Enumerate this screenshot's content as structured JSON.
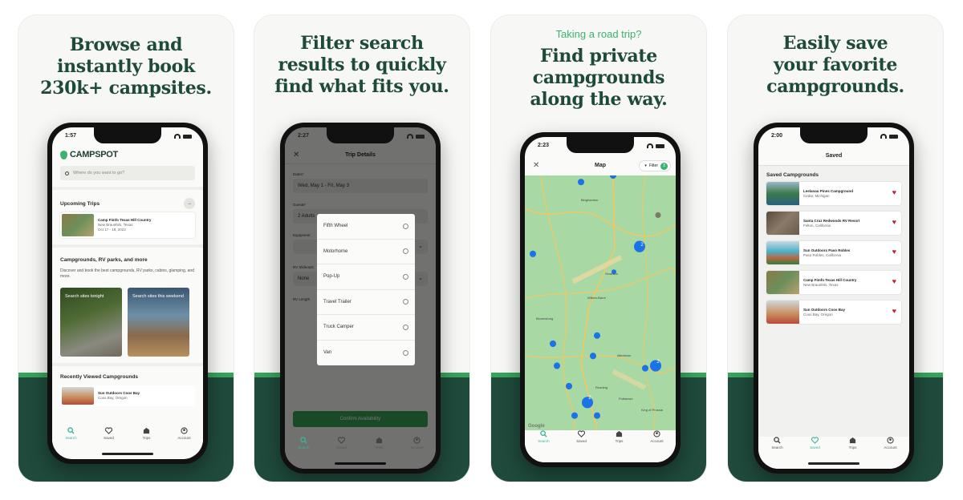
{
  "panels": [
    {
      "headline": [
        "Browse and",
        "instantly book",
        "230k+ campsites."
      ],
      "phone": {
        "time": "1:57",
        "brand": "CAMPSPOT",
        "search_placeholder": "Where do you want to go?",
        "upcoming_title": "Upcoming Trips",
        "upcoming_trip": {
          "name": "Camp Fimfo Texas Hill Country",
          "location": "New Braunfels, Texas",
          "dates": "Oct 17 - 19, 2023"
        },
        "section_title": "Campgrounds, RV parks, and more",
        "section_desc": "Discover and book the best campgrounds, RV parks, cabins, glamping, and more.",
        "promo_tonight": "Search sites tonight",
        "promo_weekend": "Search sites this weekend",
        "recent_title": "Recently Viewed Campgrounds",
        "recent_item": {
          "name": "Sun Outdoors Coos Bay",
          "location": "Coos Bay, Oregon"
        }
      }
    },
    {
      "headline": [
        "Filter search",
        "results to quickly",
        "find what fits you."
      ],
      "phone": {
        "time": "2:27",
        "title": "Trip Details",
        "dates_label": "Dates*",
        "dates_value": "Wed, May 1 - Fri, May 3",
        "guests_label": "Guests*",
        "guests_value": "2 Adults",
        "equipment_label": "Equipment",
        "slideouts_label": "RV Slideouts",
        "slideouts_value": "None",
        "length_label": "RV Length",
        "options": [
          "Fifth Wheel",
          "Motorhome",
          "Pop-Up",
          "Travel Trailer",
          "Truck Camper",
          "Van"
        ],
        "cta": "Confirm Availability"
      }
    },
    {
      "eyebrow": "Taking a road trip?",
      "headline": [
        "Find private",
        "campgrounds",
        "along the way."
      ],
      "phone": {
        "time": "2:23",
        "title": "Map",
        "filter_label": "Filter",
        "filter_count": "3",
        "map_labels": [
          "Binghamton",
          "Scranton",
          "Wilkes-Barre",
          "Bloomsburg",
          "Allentown",
          "Reading",
          "Pottstown",
          "King of Prussia"
        ],
        "cluster_counts": [
          "2",
          "2",
          "2"
        ],
        "attribution": "Google"
      }
    },
    {
      "headline": [
        "Easily save",
        "your favorite",
        "campgrounds."
      ],
      "phone": {
        "time": "2:00",
        "title": "Saved",
        "section_title": "Saved Campgrounds",
        "items": [
          {
            "name": "Leelanau Pines Campground",
            "location": "Cedar, Michigan"
          },
          {
            "name": "Santa Cruz Redwoods RV Resort",
            "location": "Felton, California"
          },
          {
            "name": "Sun Outdoors Paso Robles",
            "location": "Paso Robles, California"
          },
          {
            "name": "Camp Fimfo Texas Hill Country",
            "location": "New Braunfels, Texas"
          },
          {
            "name": "Sun Outdoors Coos Bay",
            "location": "Coos Bay, Oregon"
          }
        ]
      }
    }
  ],
  "tabbar": [
    "Search",
    "Saved",
    "Trips",
    "Account"
  ],
  "colors": {
    "brand_green": "#1e4a39",
    "accent_green": "#3bb36e",
    "band": "#1f4a3c",
    "heart": "#c0262d",
    "pin": "#1a73e8"
  }
}
